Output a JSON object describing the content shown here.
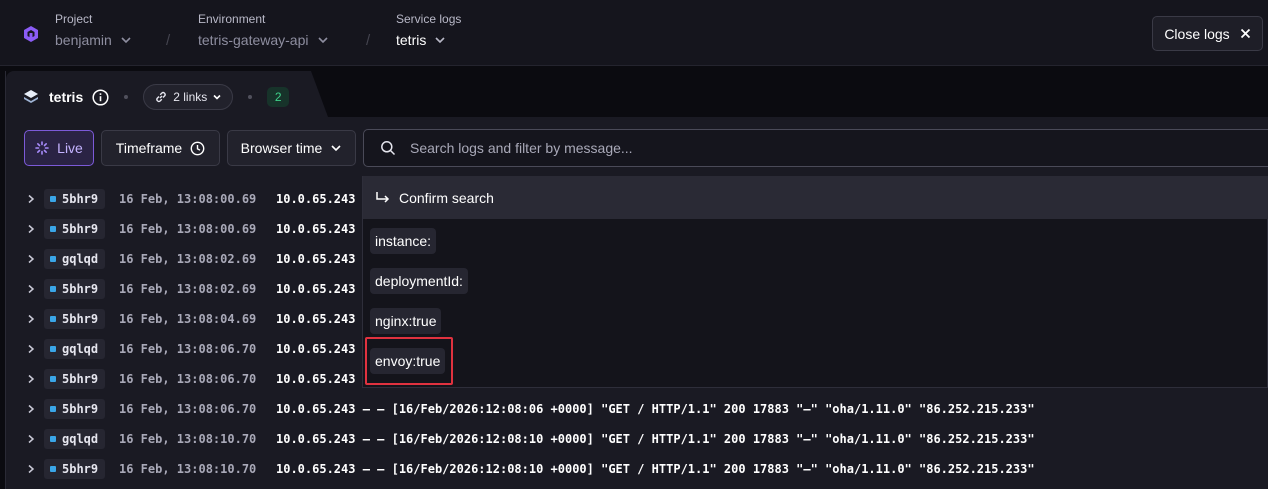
{
  "topbar": {
    "project": {
      "label": "Project",
      "value": "benjamin"
    },
    "environment": {
      "label": "Environment",
      "value": "tetris-gateway-api"
    },
    "service_logs": {
      "label": "Service logs",
      "value": "tetris"
    },
    "separator": "/",
    "close_button": "Close logs"
  },
  "tab": {
    "service_name": "tetris",
    "links_label": "2 links",
    "count": "2"
  },
  "filters": {
    "live": "Live",
    "timeframe": "Timeframe",
    "browser_time": "Browser time",
    "search_placeholder": "Search logs and filter by message..."
  },
  "dropdown": {
    "confirm": "Confirm search",
    "suggestions": [
      "instance:",
      "deploymentId:",
      "nginx:true",
      "envoy:true"
    ]
  },
  "logs": [
    {
      "instance": "5bhr9",
      "timestamp": "16 Feb, 13:08:00.69",
      "message": "10.0.65.243"
    },
    {
      "instance": "5bhr9",
      "timestamp": "16 Feb, 13:08:00.69",
      "message": "10.0.65.243"
    },
    {
      "instance": "gqlqd",
      "timestamp": "16 Feb, 13:08:02.69",
      "message": "10.0.65.243"
    },
    {
      "instance": "5bhr9",
      "timestamp": "16 Feb, 13:08:02.69",
      "message": "10.0.65.243"
    },
    {
      "instance": "5bhr9",
      "timestamp": "16 Feb, 13:08:04.69",
      "message": "10.0.65.243"
    },
    {
      "instance": "gqlqd",
      "timestamp": "16 Feb, 13:08:06.70",
      "message": "10.0.65.243"
    },
    {
      "instance": "5bhr9",
      "timestamp": "16 Feb, 13:08:06.70",
      "message": "10.0.65.243"
    },
    {
      "instance": "5bhr9",
      "timestamp": "16 Feb, 13:08:06.70",
      "message": "10.0.65.243 – – [16/Feb/2026:12:08:06 +0000] \"GET / HTTP/1.1\" 200 17883 \"–\" \"oha/1.11.0\" \"86.252.215.233\""
    },
    {
      "instance": "gqlqd",
      "timestamp": "16 Feb, 13:08:10.70",
      "message": "10.0.65.243 – – [16/Feb/2026:12:08:10 +0000] \"GET / HTTP/1.1\" 200 17883 \"–\" \"oha/1.11.0\" \"86.252.215.233\""
    },
    {
      "instance": "5bhr9",
      "timestamp": "16 Feb, 13:08:10.70",
      "message": "10.0.65.243 – – [16/Feb/2026:12:08:10 +0000] \"GET / HTTP/1.1\" 200 17883 \"–\" \"oha/1.11.0\" \"86.252.215.233\""
    }
  ]
}
